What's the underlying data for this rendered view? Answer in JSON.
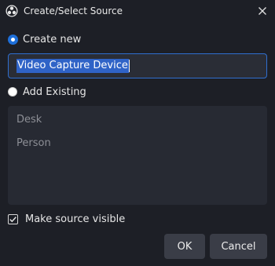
{
  "window": {
    "title": "Create/Select Source",
    "app_icon": "obs-logo-icon",
    "close_icon": "close-icon"
  },
  "create_new": {
    "label": "Create new",
    "checked": true,
    "input_value": "Video Capture Device"
  },
  "add_existing": {
    "label": "Add Existing",
    "checked": false,
    "items": [
      {
        "label": "Desk"
      },
      {
        "label": "Person"
      }
    ]
  },
  "make_visible": {
    "label": "Make source visible",
    "checked": true
  },
  "buttons": {
    "ok": "OK",
    "cancel": "Cancel"
  },
  "colors": {
    "background": "#1d1f26",
    "accent": "#2f6fd0",
    "selection": "#2f63c7",
    "button": "#3a3d47",
    "list_bg": "#272a33"
  }
}
